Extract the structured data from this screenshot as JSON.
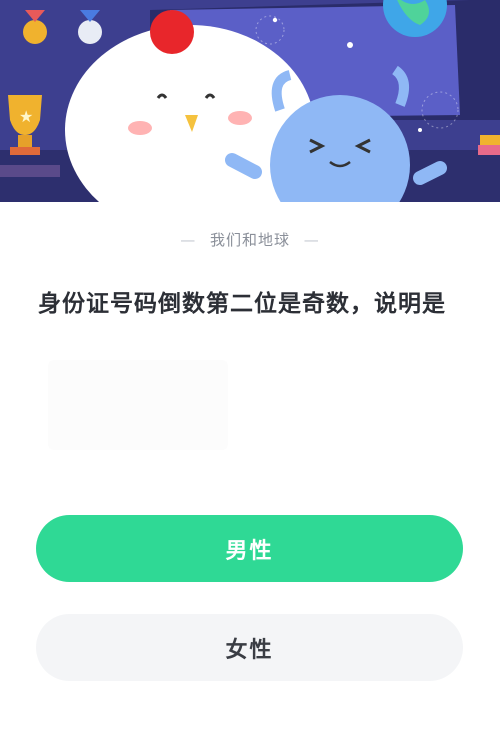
{
  "header": {
    "category_label": "我们和地球",
    "dash_left": "—",
    "dash_right": "—"
  },
  "question": {
    "text": "身份证号码倒数第二位是奇数，说明是"
  },
  "options": [
    {
      "label": "男性"
    },
    {
      "label": "女性"
    }
  ],
  "colors": {
    "primary_option_bg": "#2fd995",
    "secondary_option_bg": "#f4f5f7",
    "question_text": "#2c2f36",
    "category_text": "#8a8f99",
    "banner_bg": "#4a4aa0"
  }
}
